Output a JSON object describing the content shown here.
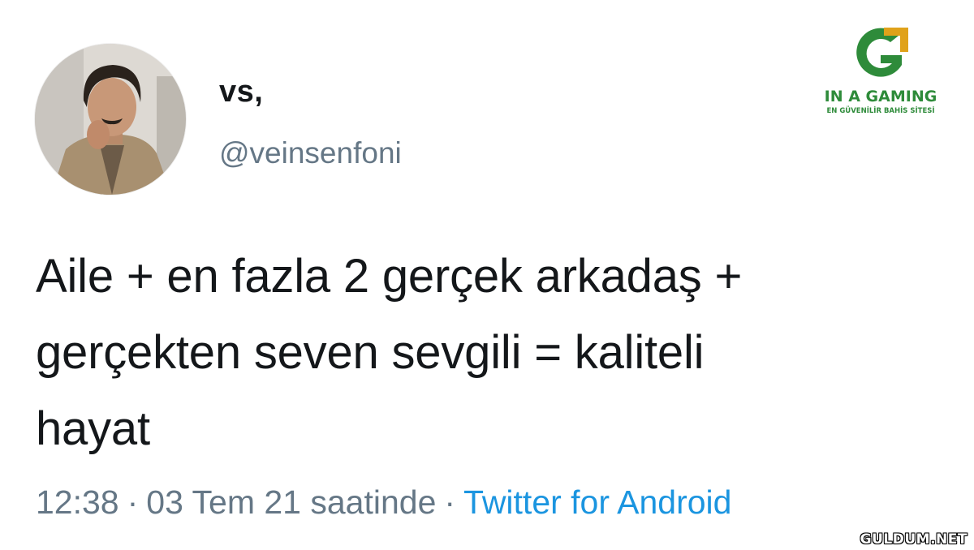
{
  "tweet": {
    "display_name": "vs,",
    "handle": "@veinsenfoni",
    "text_lines": [
      "Aile + en fazla 2 gerçek arkadaş +",
      "gerçekten seven sevgili = kaliteli",
      "hayat"
    ],
    "time": "12:38",
    "date": "03 Tem 21 saatinde",
    "separator": "·",
    "source": "Twitter for Android"
  },
  "watermarks": {
    "brand_name": "IN A GAMING",
    "brand_tagline": "EN GÜVENİLİR BAHİS SİTESİ",
    "site": "GULDUM.NET"
  },
  "colors": {
    "text": "#14171a",
    "secondary": "#657786",
    "link": "#1b95e0",
    "brand_green": "#2e8b3a",
    "brand_gold": "#e0a21a"
  },
  "icons": {
    "brand_logo": "g-letter-logo-icon",
    "avatar": "profile-photo"
  }
}
